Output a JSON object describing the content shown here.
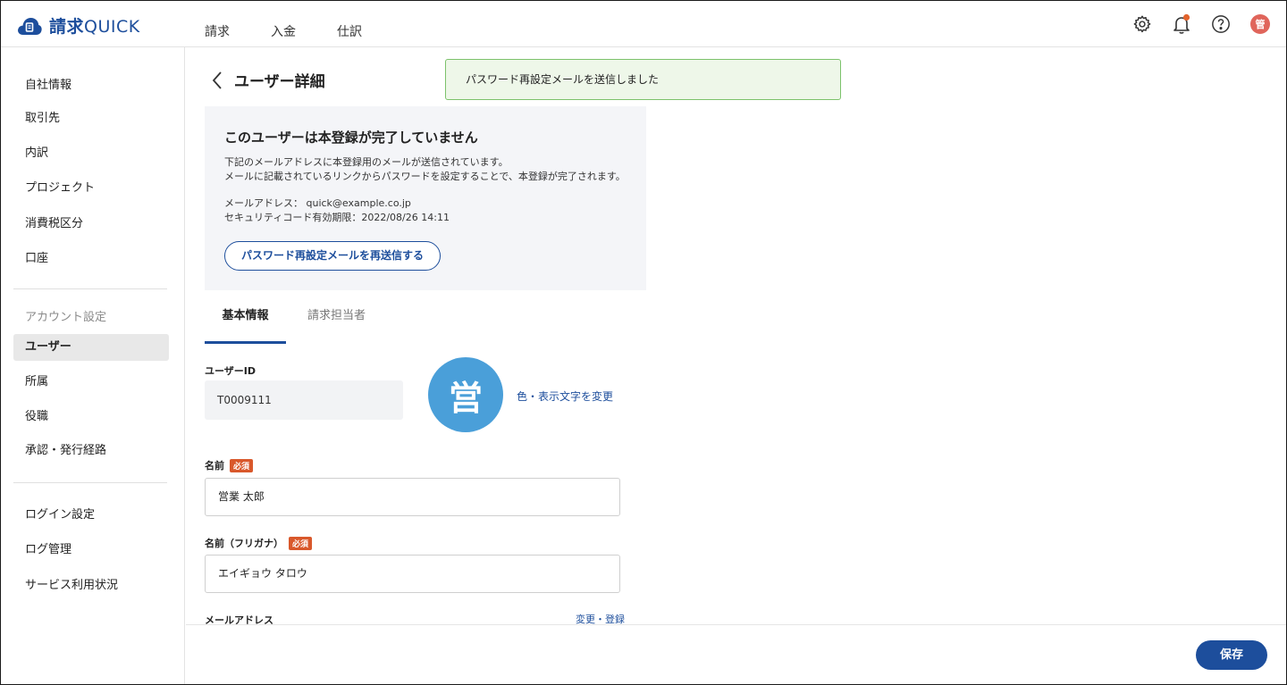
{
  "app": {
    "logo_kanji": "請求",
    "logo_latin": "QUICK"
  },
  "topnav": [
    "請求",
    "入金",
    "仕訳"
  ],
  "header_icons": [
    "gear-icon",
    "bell-icon",
    "help-icon"
  ],
  "user_avatar_initial": "管",
  "notification_dot_color": "#e2632d",
  "sidebar": {
    "group1": [
      "自社情報",
      "取引先",
      "内訳",
      "プロジェクト",
      "消費税区分",
      "口座"
    ],
    "section_label": "アカウント設定",
    "group2": [
      "ユーザー",
      "所属",
      "役職",
      "承認・発行経路"
    ],
    "active": "ユーザー",
    "group3": [
      "ログイン設定",
      "ログ管理",
      "サービス利用状況"
    ]
  },
  "page": {
    "title": "ユーザー詳細"
  },
  "toast": {
    "message": "パスワード再設定メールを送信しました"
  },
  "notice": {
    "title": "このユーザーは本登録が完了していません",
    "line1": "下記のメールアドレスに本登録用のメールが送信されています。",
    "line2": "メールに記載されているリンクからパスワードを設定することで、本登録が完了されます。",
    "email_line": "メールアドレス： quick@example.co.jp",
    "expiry_line": "セキュリティコード有効期限：2022/08/26 14:11",
    "resend_button": "パスワード再設定メールを再送信する"
  },
  "tabs": [
    "基本情報",
    "請求担当者"
  ],
  "form": {
    "user_id_label": "ユーザーID",
    "user_id_value": "T0009111",
    "avatar_char": "営",
    "avatar_color": "#4a9fd9",
    "change_avatar_link": "色・表示文字を変更",
    "name_label": "名前",
    "required_badge": "必須",
    "name_value": "営業 太郎",
    "kana_label": "名前（フリガナ）",
    "kana_value": "エイギョウ タロウ",
    "email_label": "メールアドレス",
    "email_change_link": "変更・登録"
  },
  "footer": {
    "save_button": "保存"
  },
  "colors": {
    "primary": "#1d4e9c",
    "required": "#d9582b",
    "toast_bg": "#eef7e9",
    "toast_border": "#7cc26b"
  }
}
